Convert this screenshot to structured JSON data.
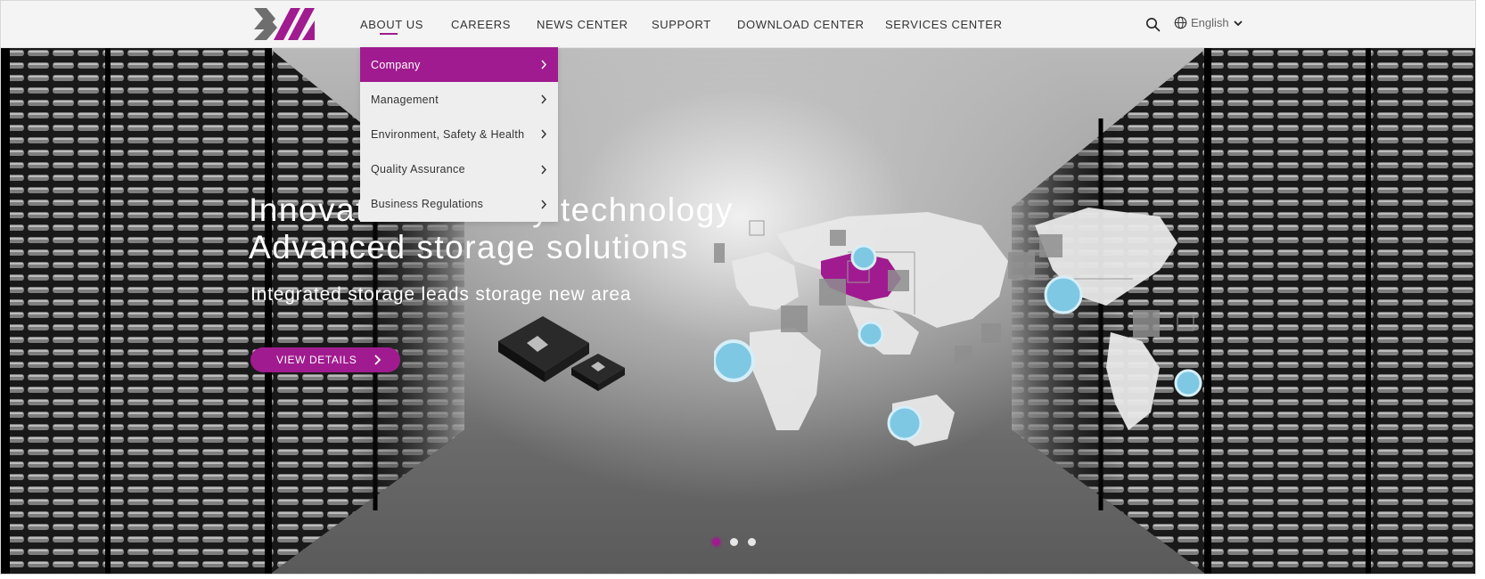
{
  "brand": {
    "accent": "#a01b8f",
    "logo_colors": [
      "#6e6e6e",
      "#a01b8f"
    ]
  },
  "nav": {
    "items": [
      {
        "label": "ABOUT US",
        "active": true
      },
      {
        "label": "CAREERS"
      },
      {
        "label": "NEWS CENTER"
      },
      {
        "label": "SUPPORT"
      },
      {
        "label": "DOWNLOAD CENTER"
      },
      {
        "label": "SERVICES CENTER"
      }
    ],
    "search_icon": "search-icon",
    "language": {
      "label": "English",
      "icon": "globe-icon",
      "caret_icon": "chevron-down-icon"
    }
  },
  "dropdown": {
    "items": [
      {
        "label": "Company",
        "active": true
      },
      {
        "label": "Management"
      },
      {
        "label": "Environment, Safety & Health"
      },
      {
        "label": "Quality Assurance"
      },
      {
        "label": "Business Regulations"
      }
    ]
  },
  "hero": {
    "title_line1": "Innovative memory technology",
    "title_line2": "Advanced storage solutions",
    "subtitle": "Integrated storage leads storage new area",
    "button_label": "VIEW DETAILS"
  },
  "carousel": {
    "count": 3,
    "active": 1
  }
}
